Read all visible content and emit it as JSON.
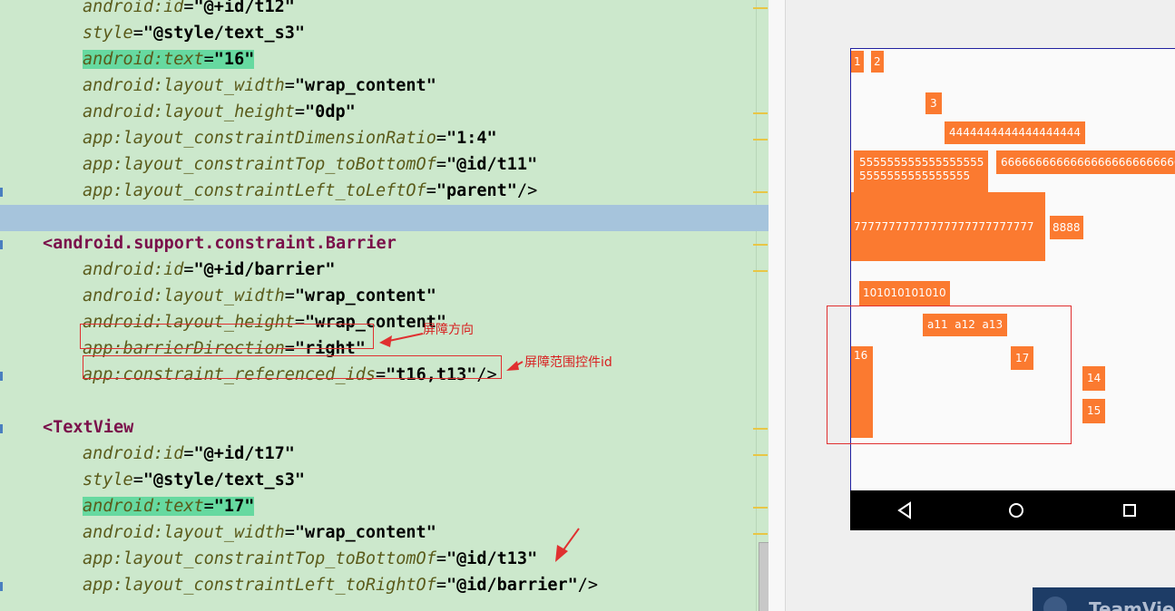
{
  "editor": {
    "lines": [
      {
        "kind": "attr",
        "indent": 2,
        "ns": "android",
        "name": "id",
        "value": "\"@+id/t12\"",
        "tail": "",
        "partial": true
      },
      {
        "kind": "attr",
        "indent": 2,
        "ns": "",
        "name": "style",
        "value": "\"@style/text_s3\"",
        "tail": ""
      },
      {
        "kind": "attr",
        "indent": 2,
        "ns": "android",
        "name": "text",
        "value": "\"16\"",
        "tail": "",
        "highlight_text": true
      },
      {
        "kind": "attr",
        "indent": 2,
        "ns": "android",
        "name": "layout_width",
        "value": "\"wrap_content\"",
        "tail": ""
      },
      {
        "kind": "attr",
        "indent": 2,
        "ns": "android",
        "name": "layout_height",
        "value": "\"0dp\"",
        "tail": ""
      },
      {
        "kind": "attr",
        "indent": 2,
        "ns": "app",
        "name": "layout_constraintDimensionRatio",
        "value": "\"1:4\"",
        "tail": ""
      },
      {
        "kind": "attr",
        "indent": 2,
        "ns": "app",
        "name": "layout_constraintTop_toBottomOf",
        "value": "\"@id/t11\"",
        "tail": ""
      },
      {
        "kind": "attr",
        "indent": 2,
        "ns": "app",
        "name": "layout_constraintLeft_toLeftOf",
        "value": "\"parent\"",
        "tail": "/>"
      },
      {
        "kind": "blank",
        "current": true
      },
      {
        "kind": "tag",
        "indent": 1,
        "text": "android.support.constraint.Barrier"
      },
      {
        "kind": "attr",
        "indent": 2,
        "ns": "android",
        "name": "id",
        "value": "\"@+id/barrier\"",
        "tail": ""
      },
      {
        "kind": "attr",
        "indent": 2,
        "ns": "android",
        "name": "layout_width",
        "value": "\"wrap_content\"",
        "tail": ""
      },
      {
        "kind": "attr",
        "indent": 2,
        "ns": "android",
        "name": "layout_height",
        "value": "\"wrap_content\"",
        "tail": ""
      },
      {
        "kind": "attr",
        "indent": 2,
        "ns": "app",
        "name": "barrierDirection",
        "value": "\"right\"",
        "tail": ""
      },
      {
        "kind": "attr",
        "indent": 2,
        "ns": "app",
        "name": "constraint_referenced_ids",
        "value": "\"t16,t13\"",
        "tail": "/>"
      },
      {
        "kind": "blank"
      },
      {
        "kind": "tag",
        "indent": 1,
        "text": "TextView"
      },
      {
        "kind": "attr",
        "indent": 2,
        "ns": "android",
        "name": "id",
        "value": "\"@+id/t17\"",
        "tail": ""
      },
      {
        "kind": "attr",
        "indent": 2,
        "ns": "",
        "name": "style",
        "value": "\"@style/text_s3\"",
        "tail": ""
      },
      {
        "kind": "attr",
        "indent": 2,
        "ns": "android",
        "name": "text",
        "value": "\"17\"",
        "tail": "",
        "highlight_text": true
      },
      {
        "kind": "attr",
        "indent": 2,
        "ns": "android",
        "name": "layout_width",
        "value": "\"wrap_content\"",
        "tail": ""
      },
      {
        "kind": "attr",
        "indent": 2,
        "ns": "app",
        "name": "layout_constraintTop_toBottomOf",
        "value": "\"@id/t13\"",
        "tail": ""
      },
      {
        "kind": "attr",
        "indent": 2,
        "ns": "app",
        "name": "layout_constraintLeft_toRightOf",
        "value": "\"@id/barrier\"",
        "tail": "/>"
      }
    ]
  },
  "annotations": {
    "barrier_direction": "屏障方向",
    "referenced_ids": "屏障范围控件id"
  },
  "preview": {
    "views": [
      "1",
      "2",
      "3",
      "4444444444444444444",
      "555555555555555555\n5555555555555555",
      "66666666666666666666666666",
      "77777777777777777777777777",
      "8888",
      "101010101010",
      "a11  a12  a13",
      "16",
      "17",
      "14",
      "15"
    ],
    "nav_icons": [
      "back-icon",
      "home-icon",
      "recents-icon"
    ],
    "overlay_text": "TeamViewer"
  },
  "colors": {
    "editor_bg": "#cce8cc",
    "attr_color": "#5a5a1a",
    "tag_color": "#7a0f4a",
    "highlight": "#66d9a0",
    "view_orange": "#fb7a30",
    "annotation_red": "#e03030"
  }
}
